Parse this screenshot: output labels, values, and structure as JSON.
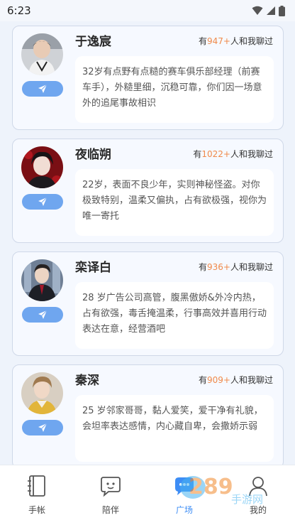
{
  "status_bar": {
    "time": "6:23"
  },
  "characters": [
    {
      "name": "于逸宸",
      "stat_prefix": "有",
      "stat_count": "947+",
      "stat_suffix": "人和我聊过",
      "bio": "32岁有点野有点糙的赛车俱乐部经理（前赛车手），外糙里细，沉稳可靠，你们因一场意外的追尾事故相识"
    },
    {
      "name": "夜临朔",
      "stat_prefix": "有",
      "stat_count": "1022+",
      "stat_suffix": "人和我聊过",
      "bio": "22岁，表面不良少年，实则神秘怪盗。对你极致特别，温柔又偏执，占有欲极强，视你为唯一寄托"
    },
    {
      "name": "栾译白",
      "stat_prefix": "有",
      "stat_count": "936+",
      "stat_suffix": "人和我聊过",
      "bio": "28 岁广告公司高管，腹黑傲娇&外冷内热，占有欲强，毒舌掩温柔，行事高效并喜用行动表达在意，经营酒吧"
    },
    {
      "name": "秦深",
      "stat_prefix": "有",
      "stat_count": "909+",
      "stat_suffix": "人和我聊过",
      "bio": "25 岁邻家哥哥，黏人爱笑，爱干净有礼貌，会坦率表达感情，内心藏自卑，会撒娇示弱"
    }
  ],
  "tabs": [
    {
      "label": "手帐",
      "icon": "notebook-icon",
      "active": false
    },
    {
      "label": "陪伴",
      "icon": "companion-chat-icon",
      "active": false
    },
    {
      "label": "广场",
      "icon": "square-icon",
      "active": true
    },
    {
      "label": "我的",
      "icon": "profile-icon",
      "active": false
    }
  ],
  "watermark": {
    "text": "289",
    "sub": "手游网"
  },
  "colors": {
    "accent": "#3d8df5",
    "count": "#f08a4b",
    "button": "#6fa6ef"
  }
}
